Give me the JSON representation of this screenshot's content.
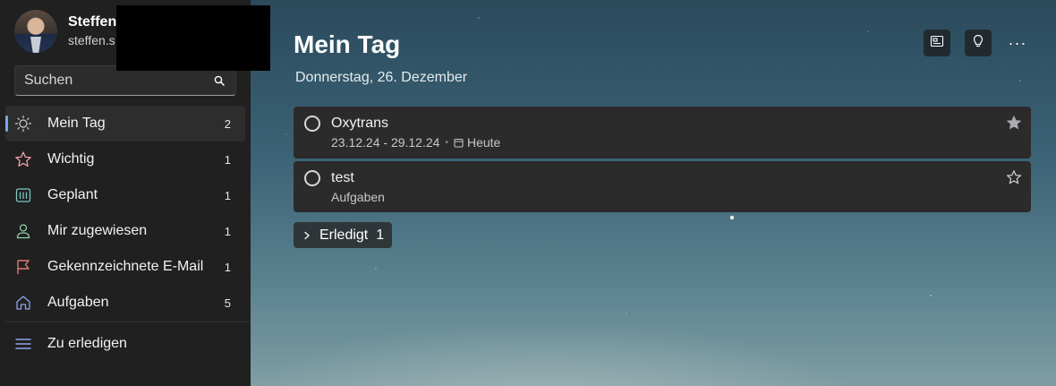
{
  "profile": {
    "name": "Steffen",
    "email": "steffen.s"
  },
  "search": {
    "placeholder": "Suchen"
  },
  "nav": [
    {
      "label": "Mein Tag",
      "count": "2",
      "icon": "sun-icon",
      "active": true
    },
    {
      "label": "Wichtig",
      "count": "1",
      "icon": "star-icon"
    },
    {
      "label": "Geplant",
      "count": "1",
      "icon": "calendar-icon"
    },
    {
      "label": "Mir zugewiesen",
      "count": "1",
      "icon": "person-icon"
    },
    {
      "label": "Gekennzeichnete E-Mail",
      "count": "1",
      "icon": "flag-icon"
    },
    {
      "label": "Aufgaben",
      "count": "5",
      "icon": "home-icon"
    }
  ],
  "extra_list": {
    "label": "Zu erledigen",
    "icon": "list-icon"
  },
  "main": {
    "title": "Mein Tag",
    "date": "Donnerstag, 26. Dezember",
    "more_label": "···"
  },
  "tasks": [
    {
      "title": "Oxytrans",
      "dates": "23.12.24 - 29.12.24",
      "separator": "•",
      "due": "Heute",
      "important": true
    },
    {
      "title": "test",
      "list": "Aufgaben",
      "important": false
    }
  ],
  "completed": {
    "label": "Erledigt",
    "count": "1"
  },
  "colors": {
    "accent": "#7aa7e8",
    "sidebar": "#202020",
    "task_bg": "#2b2b2b"
  }
}
